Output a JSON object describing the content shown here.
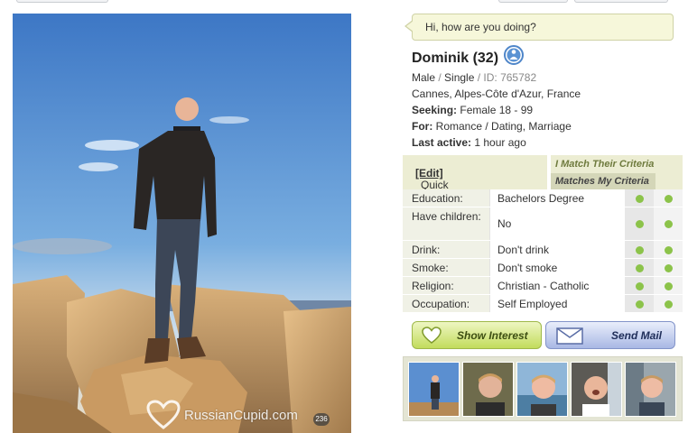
{
  "bubble": {
    "text": "Hi, how are you doing?"
  },
  "profile": {
    "name": "Dominik (32)",
    "gender": "Male",
    "status": "Single",
    "id_label": "ID: 765782",
    "location": "Cannes, Alpes-Côte d'Azur, France",
    "seeking_label": "Seeking:",
    "seeking_value": "Female 18 - 99",
    "for_label": "For:",
    "for_value": "Romance / Dating, Marriage",
    "last_active_label": "Last active:",
    "last_active_value": "1 hour ago"
  },
  "criteria": {
    "quick_view": "Quick View",
    "edit_link": "[Edit]",
    "i_match": "I Match Their Criteria",
    "matches_my": "Matches My Criteria"
  },
  "details": [
    {
      "label": "Education:",
      "value": "Bachelors Degree",
      "match_theirs": true,
      "match_mine": true
    },
    {
      "label": "Have children:",
      "value": "No",
      "match_theirs": true,
      "match_mine": true
    },
    {
      "label": "Drink:",
      "value": "Don't drink",
      "match_theirs": true,
      "match_mine": true
    },
    {
      "label": "Smoke:",
      "value": "Don't smoke",
      "match_theirs": true,
      "match_mine": true
    },
    {
      "label": "Religion:",
      "value": "Christian - Catholic",
      "match_theirs": true,
      "match_mine": true
    },
    {
      "label": "Occupation:",
      "value": "Self Employed",
      "match_theirs": true,
      "match_mine": true
    }
  ],
  "buttons": {
    "show_interest": "Show Interest",
    "send_mail": "Send Mail"
  },
  "photo": {
    "watermark": "RussianCupid.com",
    "count": "236"
  },
  "colors": {
    "match_dot": "#8cc34a",
    "bubble_bg": "#f6f7da",
    "interest_green": "#c2dc5c",
    "mail_blue": "#a9b8e4"
  },
  "thumbnails": [
    "photo-1",
    "photo-2",
    "photo-3",
    "photo-4",
    "photo-5"
  ]
}
